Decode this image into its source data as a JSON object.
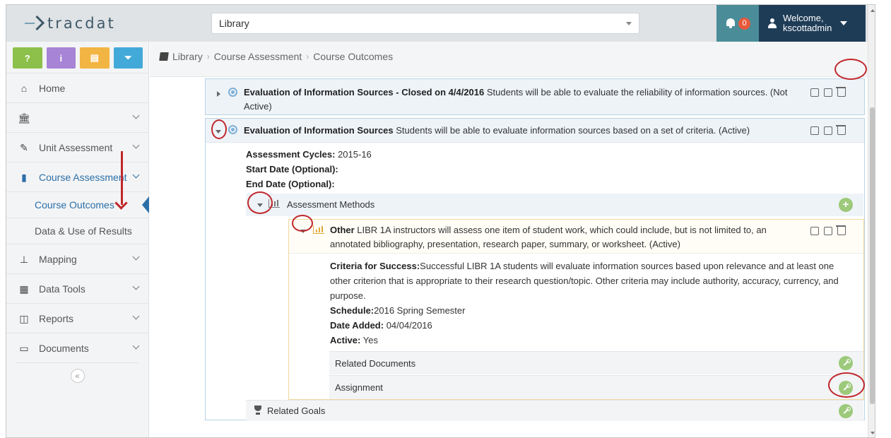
{
  "app": {
    "logo": "tracdat"
  },
  "header": {
    "unit_select": "Library",
    "notifications_count": "0",
    "user_line1": "Welcome,",
    "user_line2": "kscottadmin"
  },
  "sidebar": {
    "quick_buttons": [
      {
        "label": "?",
        "color": "#8cc04a"
      },
      {
        "label": "i",
        "color": "#a784d6"
      },
      {
        "label": "▤",
        "color": "#f2b442"
      },
      {
        "label": "⏷",
        "color": "#43a9d8"
      }
    ],
    "items": {
      "home": "Home",
      "institution": "",
      "unit_assessment": "Unit Assessment",
      "course_assessment": "Course Assessment",
      "course_outcomes": "Course Outcomes",
      "data_use": "Data & Use of Results",
      "mapping": "Mapping",
      "data_tools": "Data Tools",
      "reports": "Reports",
      "documents": "Documents"
    },
    "collapse_label": "«"
  },
  "breadcrumb": [
    "Library",
    "Course Assessment",
    "Course Outcomes"
  ],
  "outcomes": [
    {
      "title": "Evaluation of Information Sources - Closed on 4/4/2016",
      "description": "Students will be able to evaluate the reliability of information sources. (Not Active)"
    },
    {
      "title": "Evaluation of Information Sources",
      "description": "Students will be able to evaluate information sources based on a set of criteria. (Active)",
      "assessment_cycles_label": "Assessment Cycles:",
      "assessment_cycles_value": " 2015-16",
      "start_date_label": "Start Date (Optional):",
      "end_date_label": "End Date (Optional):",
      "assessment_methods_label": "Assessment Methods",
      "method": {
        "title": "Other",
        "description": "LIBR 1A instructors will assess one item of student work, which could include, but is not limited to, an annotated bibliography, presentation, research paper, summary, or worksheet. (Active)",
        "criteria_label": "Criteria for Success:",
        "criteria_value": "Successful LIBR 1A students will evaluate information sources based upon relevance and at least one other criterion that is appropriate to their research question/topic. Other criteria may include authority, accuracy, currency, and purpose.",
        "schedule_label": "Schedule:",
        "schedule_value": "2016 Spring Semester",
        "date_added_label": "Date Added:",
        "date_added_value": " 04/04/2016",
        "active_label": "Active:",
        "active_value": " Yes",
        "related_documents_label": "Related Documents",
        "assignment_label": "Assignment"
      },
      "related_goals_label": "Related Goals"
    }
  ]
}
